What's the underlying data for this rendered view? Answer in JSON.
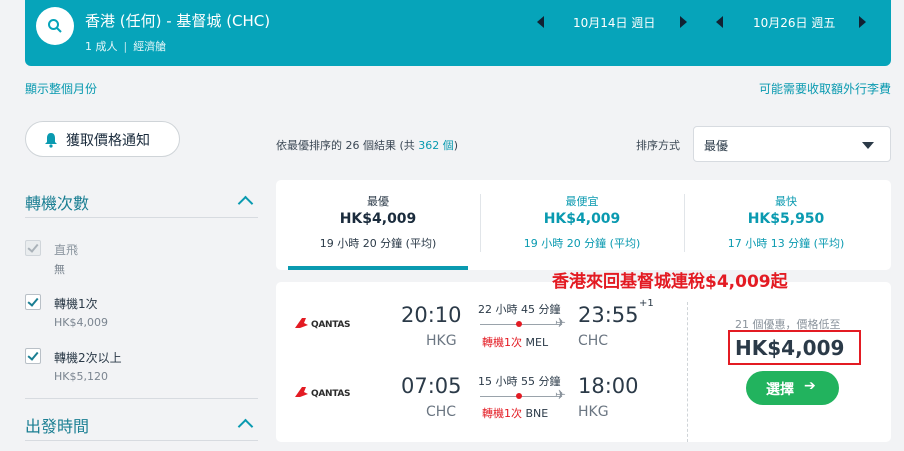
{
  "search": {
    "route": "香港 (任何) - 基督城 (CHC)",
    "passengers": "1 成人",
    "cabin": "經濟艙",
    "depart_date": "10月14日 週日",
    "return_date": "10月26日 週五"
  },
  "links": {
    "show_month": "顯示整個月份",
    "extra_fees": "可能需要收取額外行李費"
  },
  "price_alert": {
    "label": "獲取價格通知"
  },
  "filters": {
    "stops_title": "轉機次數",
    "options": [
      {
        "label": "直飛",
        "sub": "無",
        "checked": true,
        "disabled": true
      },
      {
        "label": "轉機1次",
        "sub": "HK$4,009",
        "checked": true,
        "disabled": false
      },
      {
        "label": "轉機2次以上",
        "sub": "HK$5,120",
        "checked": true,
        "disabled": false
      }
    ],
    "depart_time_title": "出發時間"
  },
  "results": {
    "prefix": "依最優排序的 26 個結果 (共 ",
    "total": "362 個",
    "suffix": ")"
  },
  "sort": {
    "label": "排序方式",
    "value": "最優"
  },
  "tabs": [
    {
      "title": "最優",
      "price": "HK$4,009",
      "duration": "19 小時 20 分鐘 (平均)"
    },
    {
      "title": "最便宜",
      "price": "HK$4,009",
      "duration": "19 小時 20 分鐘 (平均)"
    },
    {
      "title": "最快",
      "price": "HK$5,950",
      "duration": "17 小時 13 分鐘 (平均)"
    }
  ],
  "promo": "香港來回基督城連稅$4,009起",
  "result": {
    "outbound": {
      "airline": "QANTAS",
      "depart_time": "20:10",
      "depart_code": "HKG",
      "duration": "22 小時 45 分鐘",
      "stops": "轉機1次",
      "via": "MEL",
      "arrive_time": "23:55",
      "day_offset": "+1",
      "arrive_code": "CHC"
    },
    "inbound": {
      "airline": "QANTAS",
      "depart_time": "07:05",
      "depart_code": "CHC",
      "duration": "15 小時 55 分鐘",
      "stops": "轉機1次",
      "via": "BNE",
      "arrive_time": "18:00",
      "arrive_code": "HKG"
    },
    "deals": "21 個優惠，價格低至",
    "price": "HK$4,009",
    "select_label": "選擇"
  },
  "colors": {
    "brand": "#06a4ba",
    "accent": "#0a9ab0",
    "promo_red": "#e31b23",
    "select_green": "#22b35e"
  }
}
